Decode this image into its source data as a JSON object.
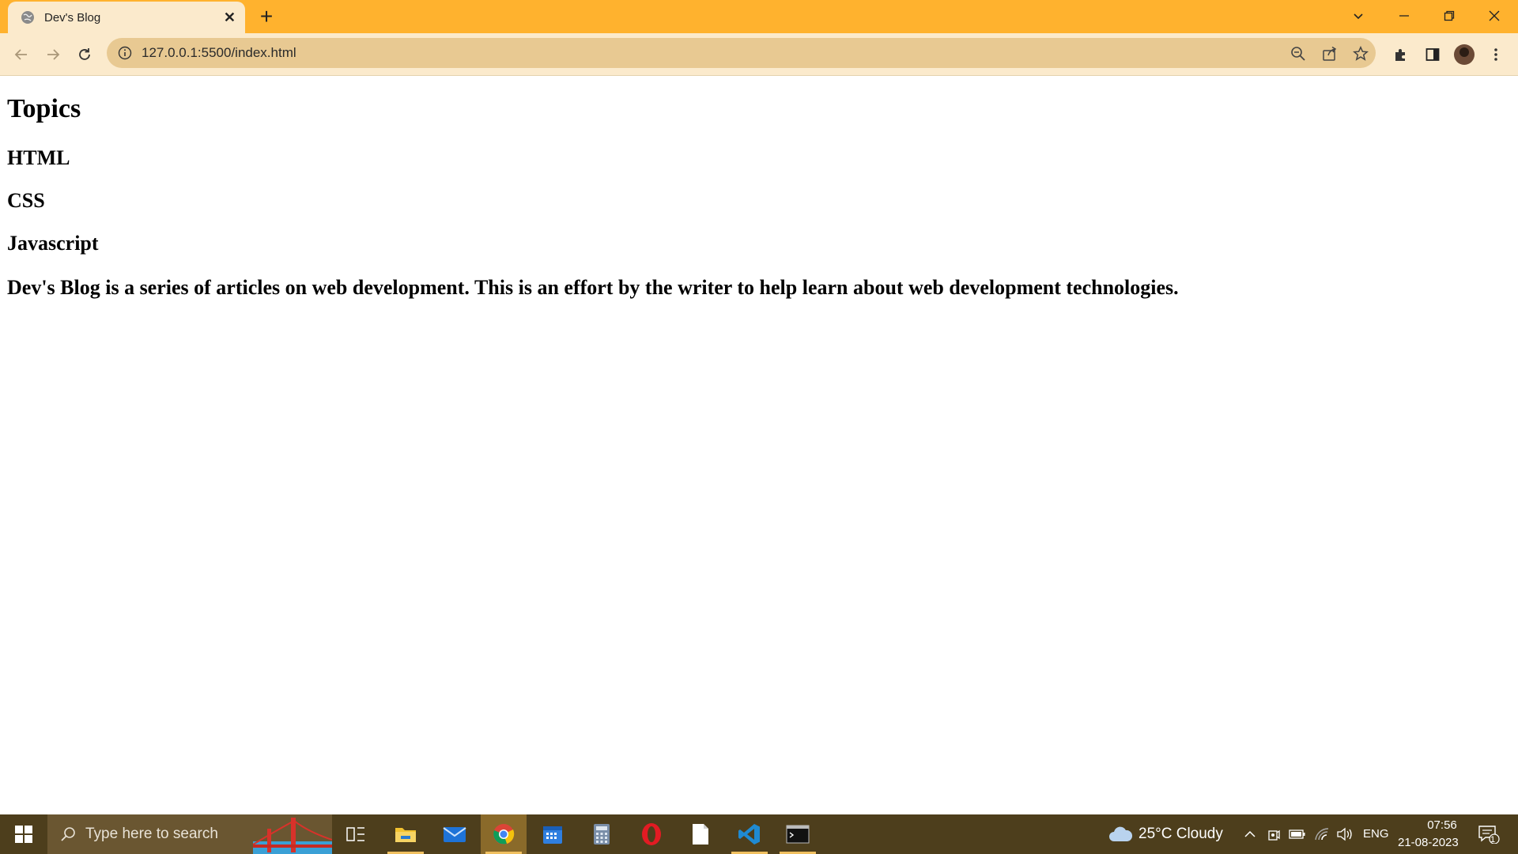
{
  "browser": {
    "tab_title": "Dev's Blog",
    "tab_close": "✕",
    "new_tab": "+",
    "url": "127.0.0.1:5500/index.html",
    "accent_color": "#ffb22e"
  },
  "page": {
    "heading": "Topics",
    "topics": [
      "HTML",
      "CSS",
      "Javascript"
    ],
    "description": "Dev's Blog is a series of articles on web development. This is an effort by the writer to help learn about web development technologies."
  },
  "taskbar": {
    "search_placeholder": "Type here to search",
    "apps": [
      "task-view",
      "file-explorer",
      "mail",
      "chrome",
      "calendar",
      "calculator",
      "opera",
      "notepad",
      "vscode",
      "terminal"
    ],
    "weather": "25°C  Cloudy",
    "language": "ENG",
    "time": "07:56",
    "date": "21-08-2023",
    "notification_count": "1"
  }
}
